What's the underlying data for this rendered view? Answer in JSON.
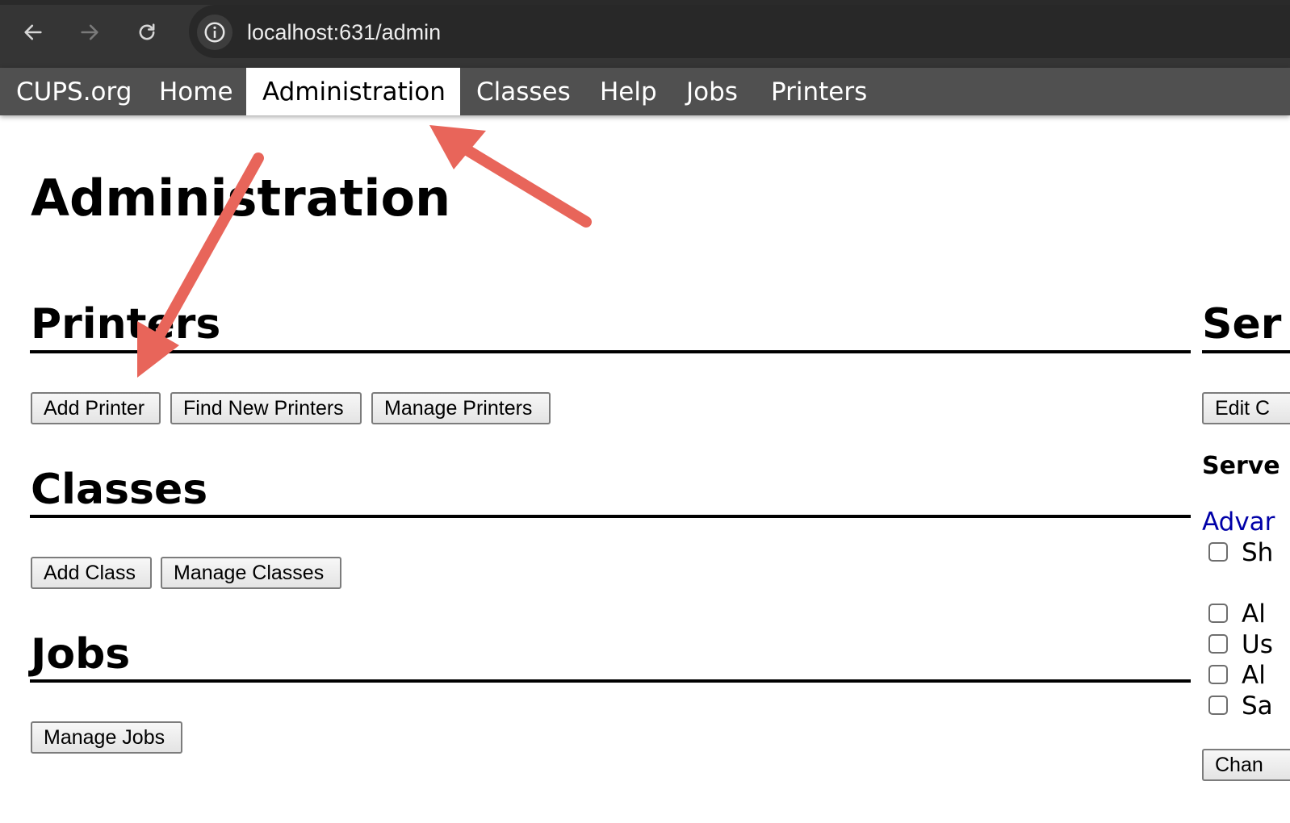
{
  "browser": {
    "url": "localhost:631/admin",
    "icons": [
      "back-arrow-icon",
      "forward-arrow-icon",
      "reload-icon",
      "info-icon"
    ]
  },
  "cups_nav": {
    "items": [
      {
        "label": "CUPS.org",
        "active": false
      },
      {
        "label": "Home",
        "active": false
      },
      {
        "label": "Administration",
        "active": true
      },
      {
        "label": "Classes",
        "active": false
      },
      {
        "label": "Help",
        "active": false
      },
      {
        "label": "Jobs",
        "active": false
      },
      {
        "label": "Printers",
        "active": false
      }
    ]
  },
  "page": {
    "title": "Administration",
    "printers": {
      "heading": "Printers",
      "buttons": [
        "Add Printer",
        "Find New Printers",
        "Manage Printers"
      ]
    },
    "classes": {
      "heading": "Classes",
      "buttons": [
        "Add Class",
        "Manage Classes"
      ]
    },
    "jobs": {
      "heading": "Jobs",
      "buttons": [
        "Manage Jobs"
      ]
    },
    "server": {
      "heading": "Ser",
      "edit_button": "Edit C",
      "settings_heading": "Serve",
      "advanced_link": "Advar",
      "checkboxes": [
        "Sh",
        "Al",
        "Us",
        "Al",
        "Sa"
      ],
      "change_button": "Chan"
    }
  },
  "annotations": {
    "arrow_color": "#e8655a"
  }
}
